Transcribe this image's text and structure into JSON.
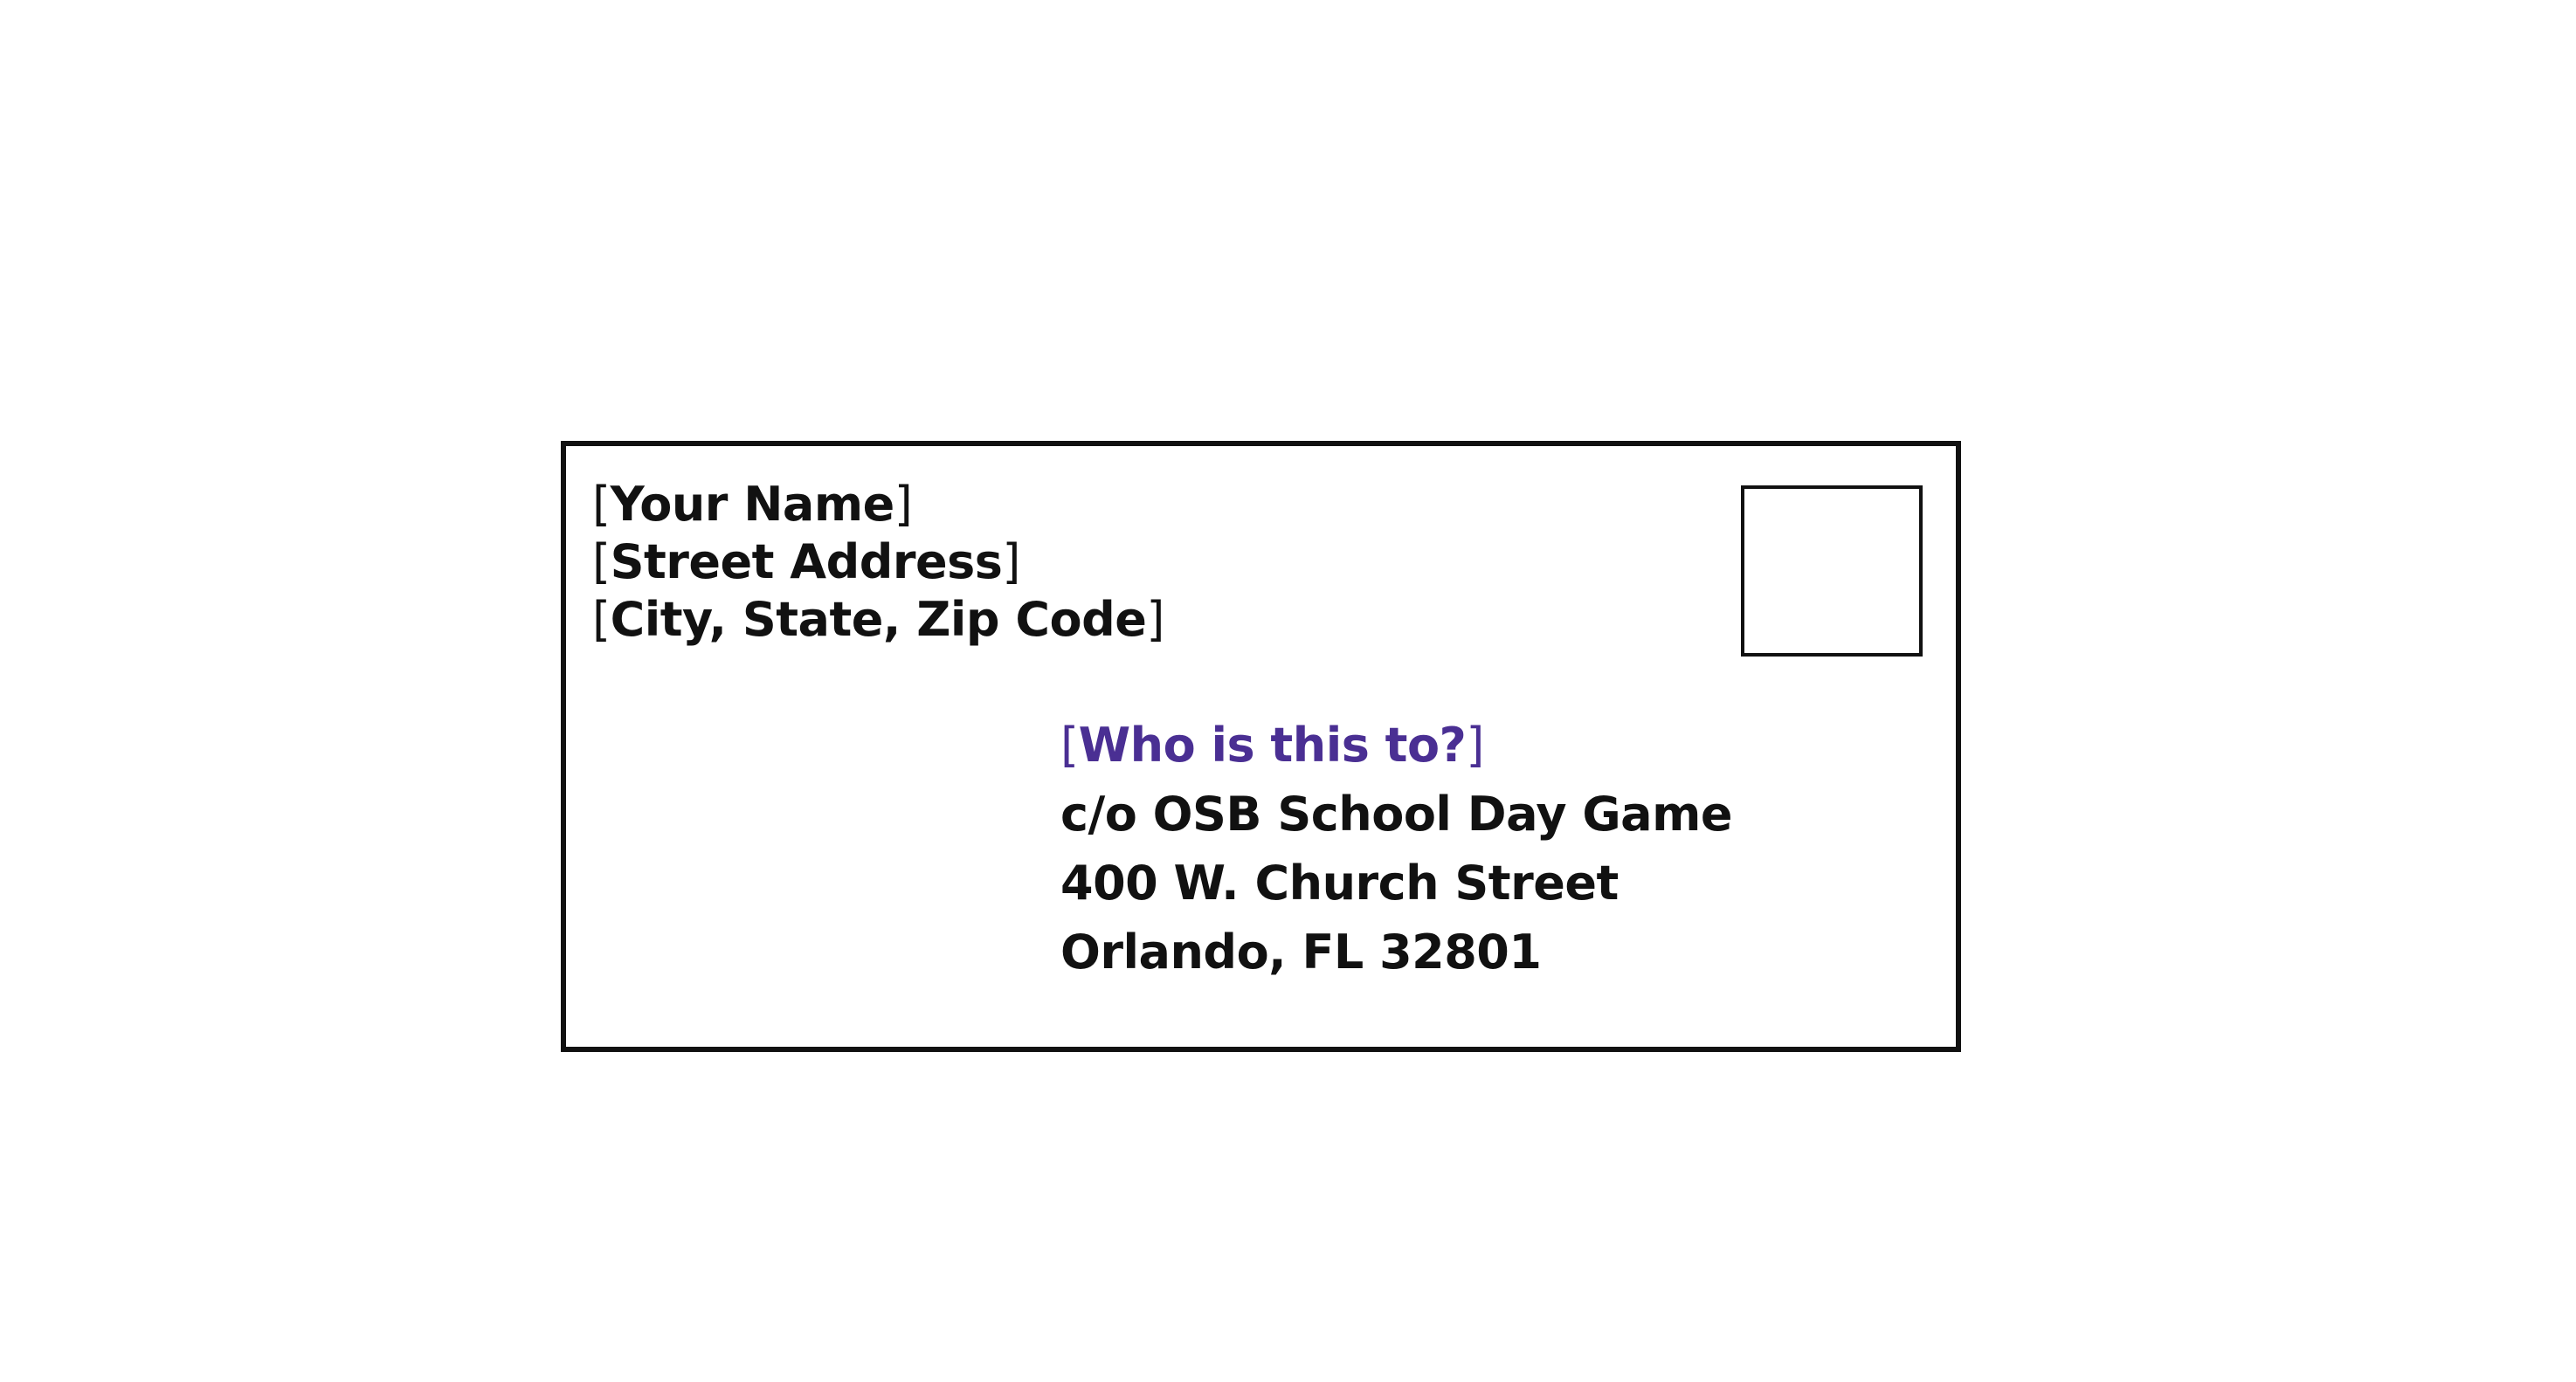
{
  "return_address": {
    "lines": [
      "Your Name",
      "Street Address",
      "City, State, Zip Code"
    ],
    "bracket_open": "[",
    "bracket_close": "]"
  },
  "recipient": {
    "addressee": "Who is this to?",
    "lines": [
      "c/o OSB School Day Game",
      "400 W. Church Street",
      "Orlando, FL 32801"
    ]
  },
  "colors": {
    "border": "#111111",
    "text": "#111111",
    "addressee": "#4a2f93"
  }
}
